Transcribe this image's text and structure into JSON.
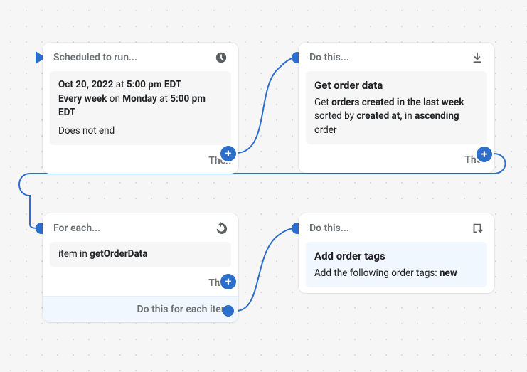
{
  "trigger": {
    "header": "Scheduled to run...",
    "date": "Oct 20, 2022",
    "at1": " at ",
    "time1": "5:00 pm EDT",
    "recur_label": "Every week",
    "on": " on ",
    "day": "Monday",
    "at2": " at ",
    "time2": "5:00 pm EDT",
    "ends": "Does not end",
    "then": "Then"
  },
  "action1": {
    "header": "Do this...",
    "title": "Get order data",
    "pre": "Get ",
    "bold1": "orders created in the last week",
    "mid1": " sorted by ",
    "bold2": "created at,",
    "mid2": " in ",
    "bold3": "ascending",
    "post": " order",
    "then": "Then"
  },
  "loop": {
    "header": "For each...",
    "item_pre": "item in ",
    "item_var": "getOrderData",
    "then": "Then",
    "footer": "Do this for each item"
  },
  "action2": {
    "header": "Do this...",
    "title": "Add order tags",
    "pre": "Add the following order tags: ",
    "bold1": "new"
  }
}
